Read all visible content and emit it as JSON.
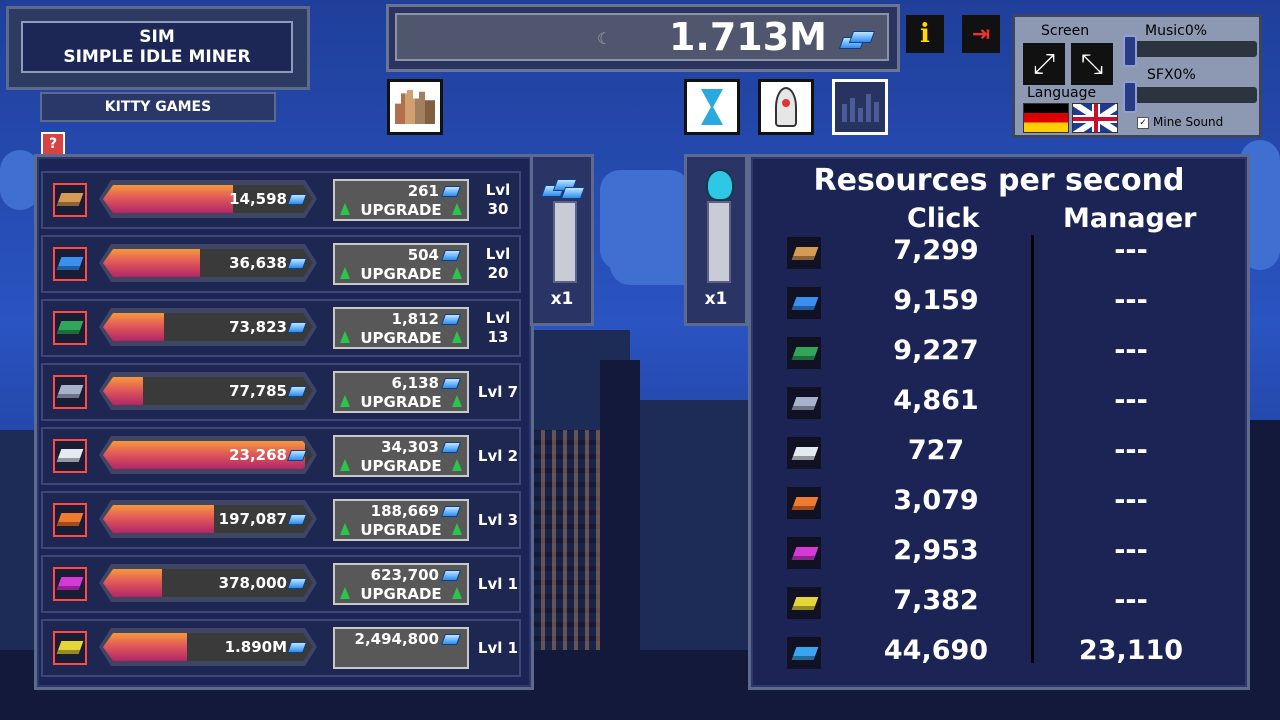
{
  "game": {
    "title_line1": "SIM",
    "title_line2": "SIMPLE IDLE MINER",
    "publisher": "KITTY GAMES",
    "help": "?"
  },
  "top": {
    "balance": "1.713M"
  },
  "settings": {
    "screen_label": "Screen",
    "language_label": "Language",
    "music_label": "Music0%",
    "sfx_label": "SFX0%",
    "mine_sound_label": "Mine Sound",
    "music_level": 0,
    "sfx_level": 0
  },
  "miners": [
    {
      "color": "#d59a54",
      "bar": "14,598",
      "fill": 0.62,
      "cost": "261",
      "upgrade": "UPGRADE",
      "lvl_top": "Lvl",
      "lvl_bottom": "30"
    },
    {
      "color": "#3a8ff0",
      "bar": "36,638",
      "fill": 0.46,
      "cost": "504",
      "upgrade": "UPGRADE",
      "lvl_top": "Lvl",
      "lvl_bottom": "20"
    },
    {
      "color": "#2fa65a",
      "bar": "73,823",
      "fill": 0.29,
      "cost": "1,812",
      "upgrade": "UPGRADE",
      "lvl_top": "Lvl",
      "lvl_bottom": "13"
    },
    {
      "color": "#a8b2cc",
      "bar": "77,785",
      "fill": 0.19,
      "cost": "6,138",
      "upgrade": "UPGRADE",
      "lvl_top": "Lvl 7",
      "lvl_bottom": ""
    },
    {
      "color": "#e4eaf0",
      "bar": "23,268",
      "fill": 0.96,
      "cost": "34,303",
      "upgrade": "UPGRADE",
      "lvl_top": "Lvl 2",
      "lvl_bottom": ""
    },
    {
      "color": "#f07a2d",
      "bar": "197,087",
      "fill": 0.53,
      "cost": "188,669",
      "upgrade": "UPGRADE",
      "lvl_top": "Lvl 3",
      "lvl_bottom": ""
    },
    {
      "color": "#d63ad6",
      "bar": "378,000",
      "fill": 0.28,
      "cost": "623,700",
      "upgrade": "UPGRADE",
      "lvl_top": "Lvl 1",
      "lvl_bottom": ""
    },
    {
      "color": "#e5d53a",
      "bar": "1.890M",
      "fill": 0.4,
      "cost": "2,494,800",
      "upgrade": "",
      "lvl_top": "Lvl 1",
      "lvl_bottom": ""
    }
  ],
  "mini_panels": [
    {
      "multiplier": "x1"
    },
    {
      "multiplier": "x1"
    }
  ],
  "resources": {
    "title": "Resources per second",
    "click_header": "Click",
    "manager_header": "Manager",
    "rows": [
      {
        "color": "#d59a54",
        "click": "7,299",
        "manager": "---"
      },
      {
        "color": "#3a8ff0",
        "click": "9,159",
        "manager": "---"
      },
      {
        "color": "#2fa65a",
        "click": "9,227",
        "manager": "---"
      },
      {
        "color": "#a8b2cc",
        "click": "4,861",
        "manager": "---"
      },
      {
        "color": "#e4eaf0",
        "click": "727",
        "manager": "---"
      },
      {
        "color": "#f07a2d",
        "click": "3,079",
        "manager": "---"
      },
      {
        "color": "#d63ad6",
        "click": "2,953",
        "manager": "---"
      },
      {
        "color": "#e5d53a",
        "click": "7,382",
        "manager": "---"
      },
      {
        "color": "#3aa4f0",
        "click": "44,690",
        "manager": "23,110"
      }
    ]
  }
}
